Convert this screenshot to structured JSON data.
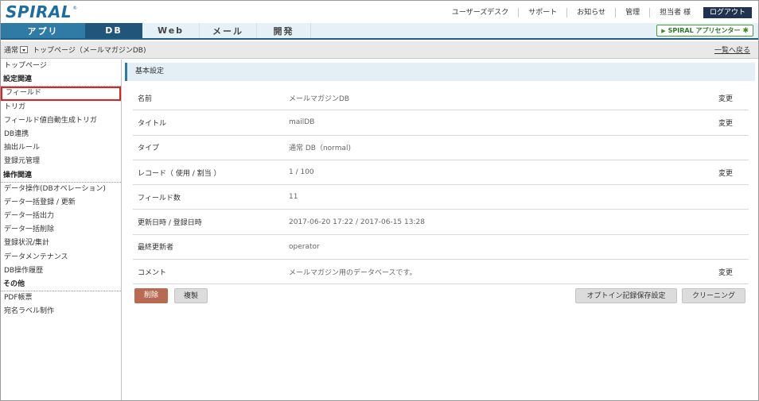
{
  "header": {
    "logo": "SPIRAL",
    "logo_mark": "®",
    "links": [
      "ユーザーズデスク",
      "サポート",
      "お知らせ",
      "管理",
      "担当者 様"
    ],
    "logout": "ログアウト"
  },
  "nav": {
    "tabs": [
      "アプリ",
      "DB",
      "Web",
      "メール",
      "開発"
    ],
    "active_tab": "DB",
    "appcenter": "SPIRAL アプリセンター"
  },
  "breadcrumb": {
    "mode": "通常",
    "path": "トップページ（メールマガジンDB)",
    "back": "一覧へ戻る"
  },
  "sidebar": {
    "top": "トップページ",
    "group1": "設定関連",
    "group1_items": [
      "フィールド",
      "トリガ",
      "フィールド値自動生成トリガ",
      "DB連携",
      "抽出ルール",
      "登録元管理"
    ],
    "group2": "操作関連",
    "group2_items": [
      "データ操作(DBオペレーション)",
      "データ一括登録 / 更新",
      "データ一括出力",
      "データ一括削除",
      "登録状況/集計",
      "データメンテナンス",
      "DB操作履歴"
    ],
    "group3": "その他",
    "group3_items": [
      "PDF帳票",
      "宛名ラベル制作"
    ],
    "active_item": "フィールド"
  },
  "main": {
    "section_title": "基本設定",
    "rows": [
      {
        "label": "名前",
        "value": "メールマガジンDB",
        "action": "変更"
      },
      {
        "label": "タイトル",
        "value": "mailDB",
        "action": "変更"
      },
      {
        "label": "タイプ",
        "value": "通常 DB（normal)",
        "action": ""
      },
      {
        "label": "レコード（ 使用 / 割当 ）",
        "value": "1 / 100",
        "action": "変更"
      },
      {
        "label": "フィールド数",
        "value": "11",
        "action": ""
      },
      {
        "label": "更新日時 / 登録日時",
        "value": "2017-06-20 17:22 / 2017-06-15 13:28",
        "action": ""
      },
      {
        "label": "最終更新者",
        "value": "operator",
        "action": ""
      },
      {
        "label": "コメント",
        "value": "メールマガジン用のデータベースです。",
        "action": "変更"
      }
    ],
    "buttons": {
      "delete": "削除",
      "copy": "複製",
      "optin": "オプトイン記録保存設定",
      "cleaning": "クリーニング"
    }
  },
  "colors": {
    "brand": "#1d6ea0",
    "nav_active": "#22557a",
    "delete": "#b96a52",
    "highlight": "#e02020"
  }
}
